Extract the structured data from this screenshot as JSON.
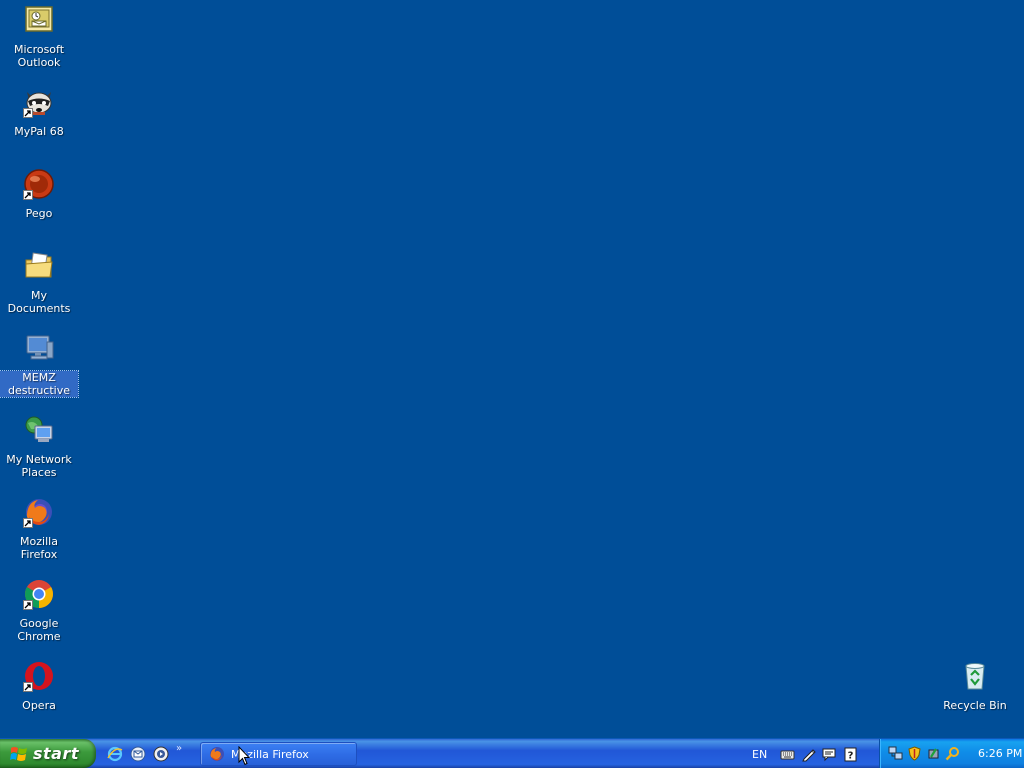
{
  "desktop": {
    "background_color": "#004e98",
    "icons": [
      {
        "label": "Microsoft Outlook",
        "icon": "outlook-icon",
        "shortcut": false,
        "selected": false
      },
      {
        "label": "MyPal 68",
        "icon": "raccoon-icon",
        "shortcut": true,
        "selected": false
      },
      {
        "label": "Pego",
        "icon": "pego-icon",
        "shortcut": true,
        "selected": false
      },
      {
        "label": "My Documents",
        "icon": "documents-folder-icon",
        "shortcut": false,
        "selected": false
      },
      {
        "label": "MEMZ destructive",
        "icon": "computer-icon",
        "shortcut": false,
        "selected": true
      },
      {
        "label": "My Network Places",
        "icon": "network-places-icon",
        "shortcut": false,
        "selected": false
      },
      {
        "label": "Mozilla Firefox",
        "icon": "firefox-icon",
        "shortcut": true,
        "selected": false
      },
      {
        "label": "Google Chrome",
        "icon": "chrome-icon",
        "shortcut": true,
        "selected": false
      },
      {
        "label": "Opera",
        "icon": "opera-icon",
        "shortcut": true,
        "selected": false
      }
    ],
    "recycle_bin": {
      "label": "Recycle Bin",
      "icon": "recycle-bin-icon"
    }
  },
  "taskbar": {
    "start_label": "start",
    "quick_launch": [
      {
        "icon": "internet-explorer-icon"
      },
      {
        "icon": "outlook-express-icon"
      },
      {
        "icon": "media-player-icon"
      }
    ],
    "quick_launch_more": "»",
    "tasks": [
      {
        "label": "Mozilla Firefox",
        "icon": "firefox-icon",
        "active": true
      }
    ],
    "language": "EN",
    "language_tools": [
      {
        "icon": "keyboard-icon"
      },
      {
        "icon": "pen-icon"
      },
      {
        "icon": "speech-icon"
      },
      {
        "icon": "help-icon"
      }
    ],
    "tray_icons": [
      {
        "icon": "network-connections-icon"
      },
      {
        "icon": "security-shield-icon"
      },
      {
        "icon": "safely-remove-icon"
      },
      {
        "icon": "search-icon"
      }
    ],
    "clock": "6:26 PM"
  }
}
